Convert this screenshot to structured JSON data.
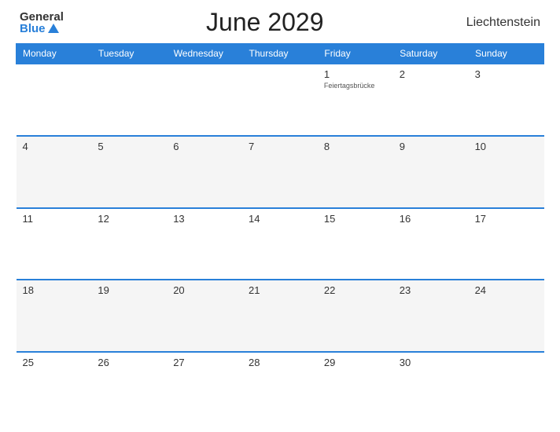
{
  "header": {
    "logo_general": "General",
    "logo_blue": "Blue",
    "title": "June 2029",
    "country": "Liechtenstein"
  },
  "calendar": {
    "days_of_week": [
      "Monday",
      "Tuesday",
      "Wednesday",
      "Thursday",
      "Friday",
      "Saturday",
      "Sunday"
    ],
    "weeks": [
      [
        {
          "day": "",
          "empty": true
        },
        {
          "day": "",
          "empty": true
        },
        {
          "day": "",
          "empty": true
        },
        {
          "day": "",
          "empty": true
        },
        {
          "day": "1",
          "event": "Feiertagsbrücke"
        },
        {
          "day": "2"
        },
        {
          "day": "3"
        }
      ],
      [
        {
          "day": "4"
        },
        {
          "day": "5"
        },
        {
          "day": "6"
        },
        {
          "day": "7"
        },
        {
          "day": "8"
        },
        {
          "day": "9"
        },
        {
          "day": "10"
        }
      ],
      [
        {
          "day": "11"
        },
        {
          "day": "12"
        },
        {
          "day": "13"
        },
        {
          "day": "14"
        },
        {
          "day": "15"
        },
        {
          "day": "16"
        },
        {
          "day": "17"
        }
      ],
      [
        {
          "day": "18"
        },
        {
          "day": "19"
        },
        {
          "day": "20"
        },
        {
          "day": "21"
        },
        {
          "day": "22"
        },
        {
          "day": "23"
        },
        {
          "day": "24"
        }
      ],
      [
        {
          "day": "25"
        },
        {
          "day": "26"
        },
        {
          "day": "27"
        },
        {
          "day": "28"
        },
        {
          "day": "29"
        },
        {
          "day": "30"
        },
        {
          "day": "",
          "empty": true
        }
      ]
    ]
  }
}
